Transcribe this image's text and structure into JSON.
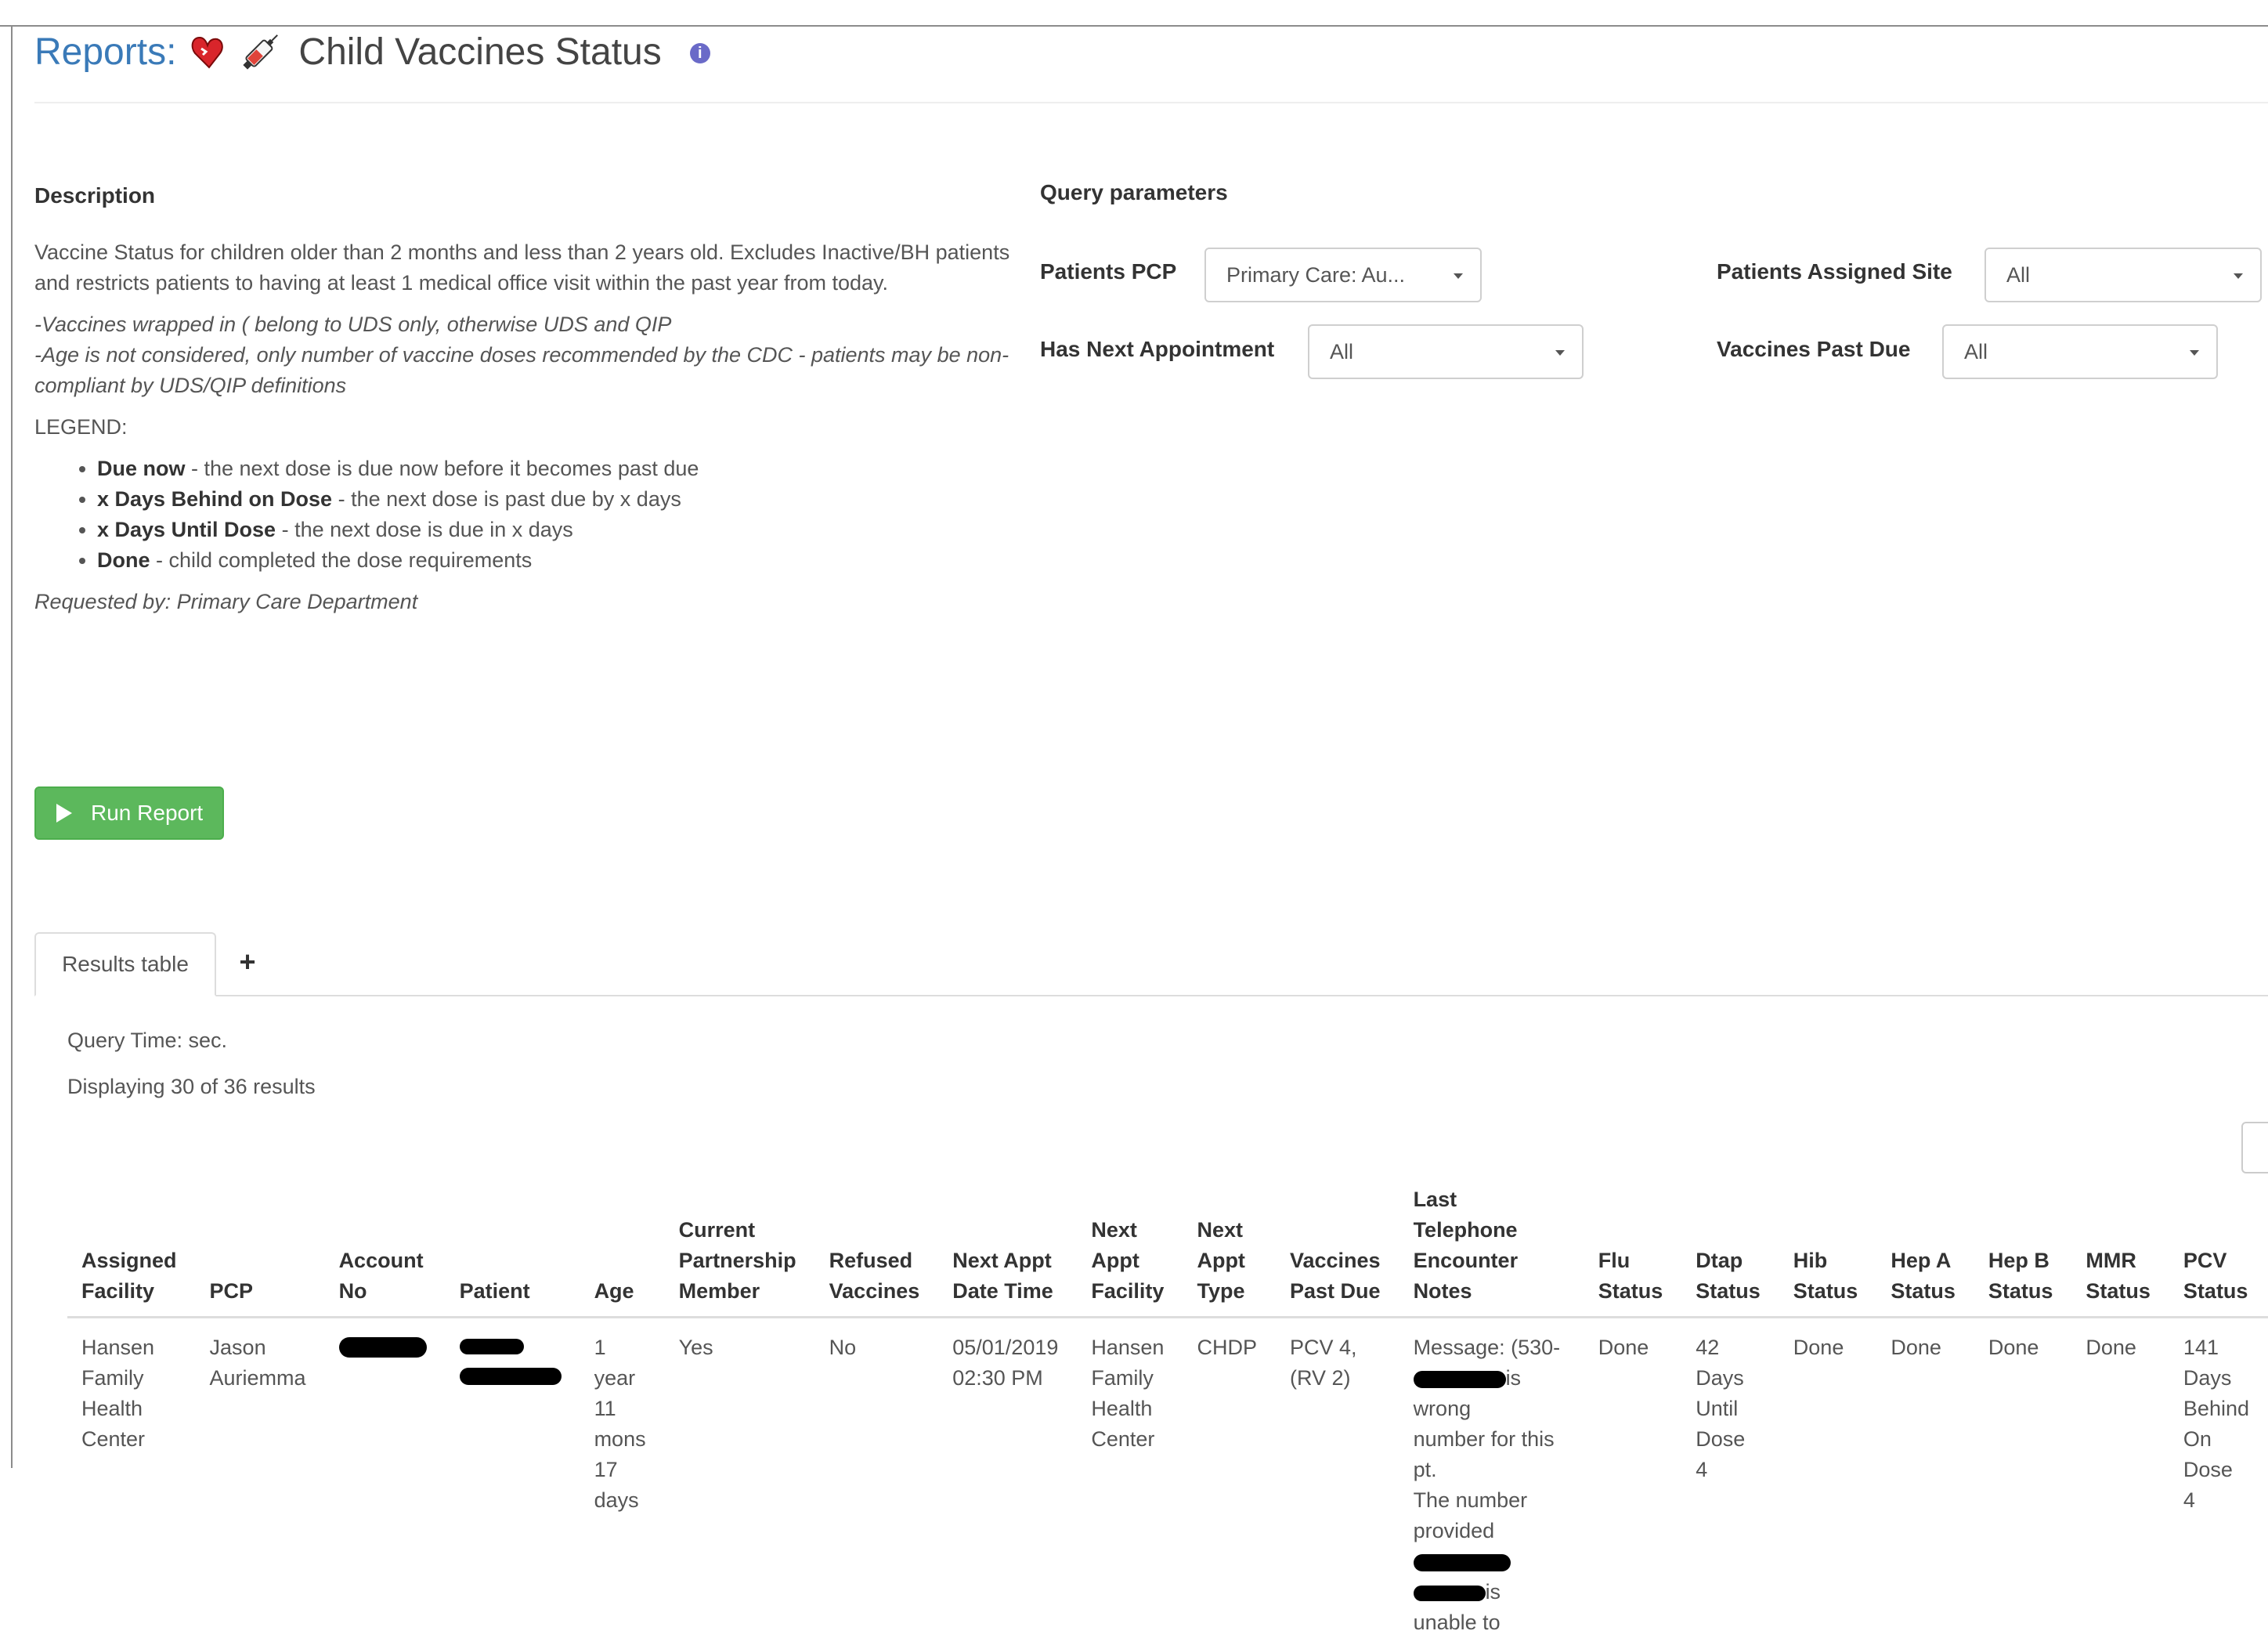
{
  "header": {
    "reports_label": "Reports:",
    "report_title": "Child Vaccines Status"
  },
  "description": {
    "heading": "Description",
    "summary": "Vaccine Status for children older than 2 months and less than 2 years old. Excludes Inactive/BH patients and restricts patients to having at least 1 medical office visit within the past year from today.",
    "note1": "-Vaccines wrapped in ( belong to UDS only, otherwise UDS and QIP",
    "note2": "-Age is not considered, only number of vaccine doses recommended by the CDC - patients may be non-compliant by UDS/QIP definitions",
    "legend_label": "LEGEND:",
    "legend_items": [
      {
        "term": "Due now",
        "text": " - the next dose is due now before it becomes past due"
      },
      {
        "term": "x Days Behind on Dose",
        "text": " - the next dose is past due by x days"
      },
      {
        "term": "x Days Until Dose",
        "text": " - the next dose is due in x days"
      },
      {
        "term": "Done",
        "text": " - child completed the dose requirements"
      }
    ],
    "requested_by": "Requested by: Primary Care Department"
  },
  "query_params": {
    "heading": "Query parameters",
    "patients_pcp": {
      "label": "Patients PCP",
      "value": "Primary Care: Au..."
    },
    "patients_assigned_site": {
      "label": "Patients Assigned Site",
      "value": "All"
    },
    "has_next_appointment": {
      "label": "Has Next Appointment",
      "value": "All"
    },
    "vaccines_past_due": {
      "label": "Vaccines Past Due",
      "value": "All"
    }
  },
  "run_button": {
    "label": "Run Report"
  },
  "tabs": {
    "results_label": "Results table",
    "add_label": "+"
  },
  "results": {
    "query_time": "Query Time: sec.",
    "displaying": "Displaying 30 of 36 results",
    "headers": {
      "assigned_facility": [
        "Assigned",
        "Facility"
      ],
      "pcp": [
        "PCP"
      ],
      "account_no": [
        "Account",
        "No"
      ],
      "patient": [
        "Patient"
      ],
      "age": [
        "Age"
      ],
      "current_partnership_member": [
        "Current",
        "Partnership",
        "Member"
      ],
      "refused_vaccines": [
        "Refused",
        "Vaccines"
      ],
      "next_appt_date_time": [
        "Next Appt",
        "Date Time"
      ],
      "next_appt_facility": [
        "Next",
        "Appt",
        "Facility"
      ],
      "next_appt_type": [
        "Next",
        "Appt",
        "Type"
      ],
      "vaccines_past_due": [
        "Vaccines",
        "Past Due"
      ],
      "last_telephone_encounter_notes": [
        "Last Telephone",
        "Encounter Notes"
      ],
      "flu_status": [
        "Flu",
        "Status"
      ],
      "dtap_status": [
        "Dtap",
        "Status"
      ],
      "hib_status": [
        "Hib",
        "Status"
      ],
      "hep_a_status": [
        "Hep A",
        "Status"
      ],
      "hep_b_status": [
        "Hep B",
        "Status"
      ],
      "mmr_status": [
        "MMR",
        "Status"
      ],
      "pcv_status": [
        "PCV",
        "Status"
      ]
    },
    "row1": {
      "assigned_facility": [
        "Hansen",
        "Family",
        "Health",
        "Center"
      ],
      "pcp": [
        "Jason",
        "Auriemma"
      ],
      "age": [
        "1",
        "year",
        "11",
        "mons",
        "17",
        "days"
      ],
      "current_partnership_member": "Yes",
      "refused_vaccines": "No",
      "next_appt_date_time": [
        "05/01/2019",
        "02:30 PM"
      ],
      "next_appt_facility": [
        "Hansen",
        "Family",
        "Health",
        "Center"
      ],
      "next_appt_type": "CHDP",
      "vaccines_past_due": [
        "PCV 4,",
        "(RV 2)"
      ],
      "notes_line1": "Message: (530-",
      "notes_line2": "is wrong",
      "notes_line3": "number for this pt.",
      "notes_line4": "The number",
      "notes_line5": "provided",
      "notes_line6": "is unable to",
      "flu_status": "Done",
      "dtap_status": [
        "42",
        "Days",
        "Until",
        "Dose",
        "4"
      ],
      "hib_status": "Done",
      "hep_a_status": "Done",
      "hep_b_status": "Done",
      "mmr_status": "Done",
      "pcv_status": [
        "141",
        "Days",
        "Behind",
        "On",
        "Dose",
        "4"
      ]
    }
  }
}
